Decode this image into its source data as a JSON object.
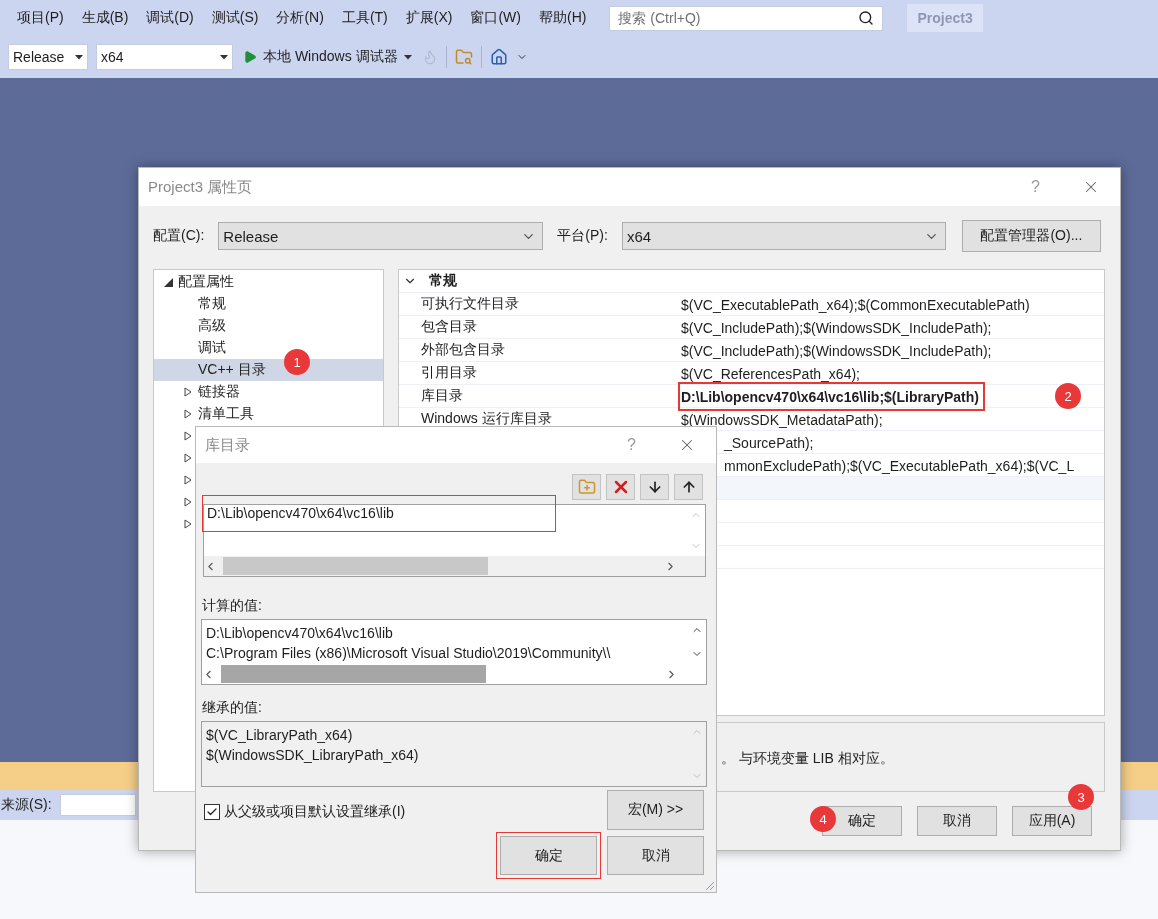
{
  "menu": [
    "项目(P)",
    "生成(B)",
    "调试(D)",
    "测试(S)",
    "分析(N)",
    "工具(T)",
    "扩展(X)",
    "窗口(W)",
    "帮助(H)"
  ],
  "search": {
    "placeholder": "搜索 (Ctrl+Q)"
  },
  "project_badge": "Project3",
  "toolbar": {
    "configuration": "Release",
    "platform": "x64",
    "debugger": "本地 Windows 调试器"
  },
  "source_bar": {
    "label": "来源(S):"
  },
  "property_dialog": {
    "title": "Project3 属性页",
    "help": "?",
    "config_label": "配置(C):",
    "config_value": "Release",
    "platform_label": "平台(P):",
    "platform_value": "x64",
    "manager_button": "配置管理器(O)...",
    "tree": [
      {
        "label": "配置属性",
        "expanded": true,
        "selected": false,
        "children": [
          {
            "label": "常规",
            "selected": false
          },
          {
            "label": "高级",
            "selected": false
          },
          {
            "label": "调试",
            "selected": false
          },
          {
            "label": "VC++ 目录",
            "selected": true,
            "marker": "1"
          },
          {
            "label": "链接器",
            "selected": false,
            "expanded": false
          },
          {
            "label": "清单工具",
            "selected": false,
            "expanded": false
          },
          {
            "selected": false,
            "expanded": false
          },
          {
            "selected": false,
            "expanded": false
          },
          {
            "selected": false,
            "expanded": false
          },
          {
            "selected": false,
            "expanded": false
          },
          {
            "selected": false,
            "expanded": false
          }
        ]
      }
    ],
    "group": {
      "label": "常规",
      "expanded": true
    },
    "rows": [
      {
        "kind": "full",
        "name": "可执行文件目录",
        "value": "$(VC_ExecutablePath_x64);$(CommonExecutablePath)",
        "selected": false,
        "highlighted": false
      },
      {
        "kind": "full",
        "name": "包含目录",
        "value": "$(VC_IncludePath);$(WindowsSDK_IncludePath);",
        "selected": false,
        "highlighted": false
      },
      {
        "kind": "full",
        "name": "外部包含目录",
        "value": "$(VC_IncludePath);$(WindowsSDK_IncludePath);",
        "selected": false,
        "highlighted": false
      },
      {
        "kind": "full",
        "name": "引用目录",
        "value": "$(VC_ReferencesPath_x64);",
        "selected": false,
        "highlighted": false
      },
      {
        "kind": "full",
        "name": "库目录",
        "value": "D:\\Lib\\opencv470\\x64\\vc16\\lib;$(LibraryPath)",
        "selected": false,
        "highlighted": true,
        "marker": "2"
      },
      {
        "kind": "full",
        "name": "Windows 运行库目录",
        "value": "$(WindowsSDK_MetadataPath);",
        "selected": false,
        "highlighted": false
      },
      {
        "kind": "covered",
        "value": "_SourcePath);",
        "selected": false,
        "highlighted": false
      },
      {
        "kind": "covered",
        "value": "mmonExcludePath);$(VC_ExecutablePath_x64);$(VC_L",
        "selected": false,
        "highlighted": false
      },
      {
        "kind": "covered",
        "selected": true,
        "highlighted": false
      }
    ],
    "description": "。 与环境变量 LIB 相对应。",
    "buttons": [
      {
        "label": "确定",
        "marker": "4"
      },
      {
        "label": "取消"
      },
      {
        "label": "应用(A)",
        "marker": "3"
      }
    ]
  },
  "library_dialog": {
    "title": "库目录",
    "help": "?",
    "entries": [
      {
        "text": "D:\\Lib\\opencv470\\x64\\vc16\\lib",
        "highlighted": true
      }
    ],
    "computed_label": "计算的值:",
    "computed": [
      "D:\\Lib\\opencv470\\x64\\vc16\\lib",
      "C:\\Program Files (x86)\\Microsoft Visual Studio\\2019\\Community\\\\"
    ],
    "inherited_label": "继承的值:",
    "inherited": [
      "$(VC_LibraryPath_x64)",
      "$(WindowsSDK_LibraryPath_x64)"
    ],
    "inherit": {
      "label": "从父级或项目默认设置继承(I)",
      "checked": true
    },
    "macro_button": "宏(M) >>",
    "buttons": [
      {
        "label": "确定",
        "highlighted": true
      },
      {
        "label": "取消",
        "highlighted": false
      }
    ]
  }
}
